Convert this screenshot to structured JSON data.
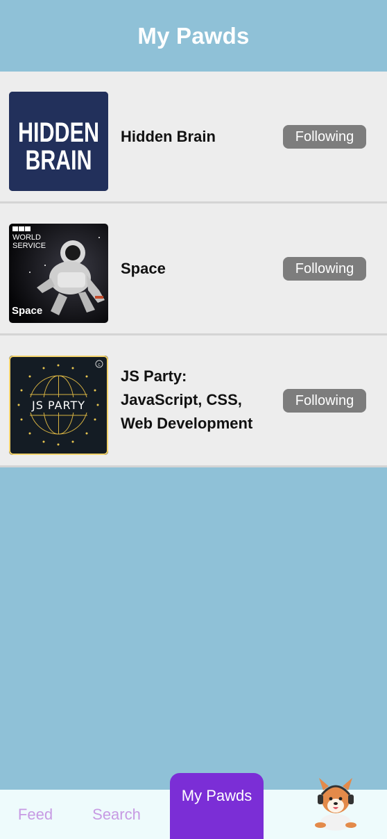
{
  "header": {
    "title": "My Pawds"
  },
  "podcasts": [
    {
      "title": "Hidden Brain",
      "button_label": "Following",
      "cover": {
        "line1": "HIDDEN",
        "line2": "BRAIN"
      }
    },
    {
      "title": "Space",
      "button_label": "Following",
      "cover": {
        "brand": "BBC",
        "line1": "WORLD",
        "line2": "SERVICE",
        "caption": "Space"
      }
    },
    {
      "title": "JS Party: JavaScript, CSS, Web Development",
      "button_label": "Following",
      "cover": {
        "text": "JS PARTY",
        "badge": "c"
      }
    }
  ],
  "tabbar": {
    "tabs": [
      {
        "label": "Feed"
      },
      {
        "label": "Search"
      },
      {
        "label": "My Pawds",
        "active": true
      }
    ],
    "avatar_icon": "corgi-headphones-icon"
  },
  "colors": {
    "background": "#8fc1d7",
    "row": "#ededed",
    "button": "#7d7d7d",
    "active_tab": "#7b2ed6",
    "inactive_tab_text": "#c79ae3",
    "tabbar": "#eefbfc"
  }
}
